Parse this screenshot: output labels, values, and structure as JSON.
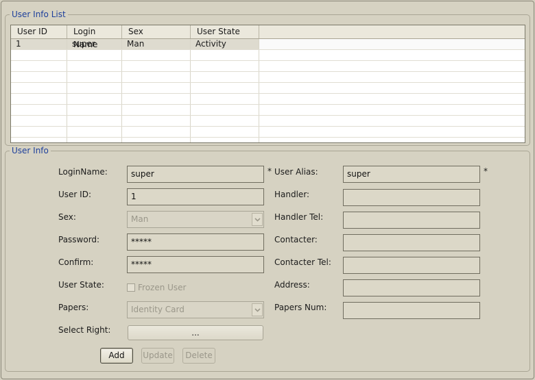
{
  "list_group": {
    "title": "User Info List",
    "columns": [
      "User ID",
      "Login Name",
      "Sex",
      "User State"
    ],
    "rows": [
      {
        "id": "1",
        "login": "super",
        "sex": "Man",
        "state": "Activity"
      }
    ]
  },
  "form_group": {
    "title": "User Info",
    "login_name": {
      "label": "LoginName:",
      "value": "super"
    },
    "user_id": {
      "label": "User ID:",
      "value": "1"
    },
    "sex": {
      "label": "Sex:",
      "value": "Man"
    },
    "password": {
      "label": "Password:",
      "value": "*****"
    },
    "confirm": {
      "label": "Confirm:",
      "value": "*****"
    },
    "user_state": {
      "label": "User State:",
      "checkbox_label": "Frozen User"
    },
    "papers": {
      "label": "Papers:",
      "value": "Identity Card"
    },
    "select_right": {
      "label": "Select Right:",
      "button": "..."
    },
    "user_alias": {
      "label": "User Alias:",
      "value": "super"
    },
    "handler": {
      "label": "Handler:",
      "value": ""
    },
    "handler_tel": {
      "label": "Handler Tel:",
      "value": ""
    },
    "contacter": {
      "label": "Contacter:",
      "value": ""
    },
    "contacter_tel": {
      "label": "Contacter Tel:",
      "value": ""
    },
    "address": {
      "label": "Address:",
      "value": ""
    },
    "papers_num": {
      "label": "Papers Num:",
      "value": ""
    },
    "required_mark": "*"
  },
  "buttons": {
    "add": "Add",
    "update": "Update",
    "delete": "Delete"
  }
}
